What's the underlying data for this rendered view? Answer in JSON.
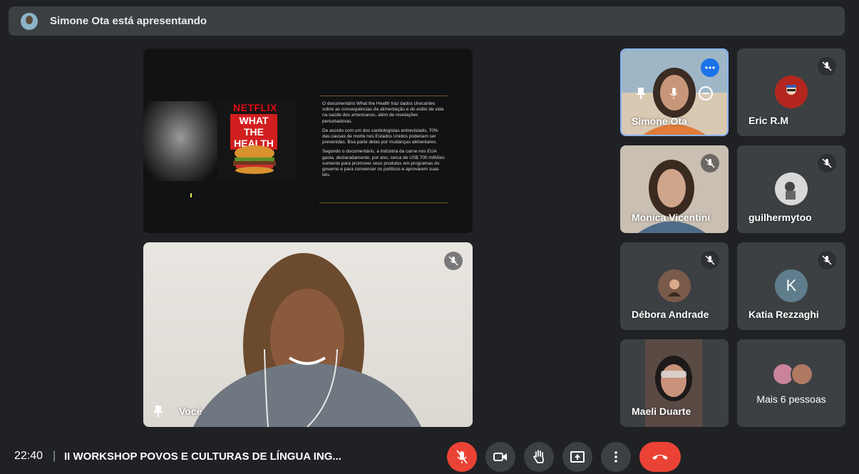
{
  "banner": {
    "presenter_text": "Simone Ota está apresentando"
  },
  "slide": {
    "brand": "NETFLIX",
    "title_line1": "WHAT THE",
    "title_line2": "HEALTH",
    "para1": "O documentário What the Health traz dados chocantes sobre as consequências da alimentação e do estilo de vida na saúde dos americanos, além de revelações perturbadoras.",
    "para2": "De acordo com um dos cardiologistas entrevistado, 70% das causas de morte nos Estados Unidos poderiam ser prevenidas. Boa parte delas por mudanças alimentares.",
    "para3": "Segundo o documentário, a indústria da carne nos EUA gasta, declaradamente, por ano, cerca de US$ 700 milhões somente para promover seus produtos em programas do governo e para convencer os políticos e aprovarem suas leis."
  },
  "self_tile": {
    "name": "Você"
  },
  "participants": [
    {
      "name": "Simone Ota"
    },
    {
      "name": "Eric R.M"
    },
    {
      "name": "Monica Vicentini"
    },
    {
      "name": "guilhermytoo"
    },
    {
      "name": "Débora Andrade"
    },
    {
      "name": "Katia Rezzaghi",
      "initial": "K"
    },
    {
      "name": "Maeli Duarte"
    }
  ],
  "more": {
    "label": "Mais 6 pessoas"
  },
  "bottom": {
    "time": "22:40",
    "separator": "|",
    "meeting_title": "II WORKSHOP POVOS E CULTURAS DE LÍNGUA ING..."
  },
  "colors": {
    "background": "#202124",
    "tile": "#3c4043",
    "end_call": "#ea4335",
    "active_border": "#8ab4f8"
  }
}
